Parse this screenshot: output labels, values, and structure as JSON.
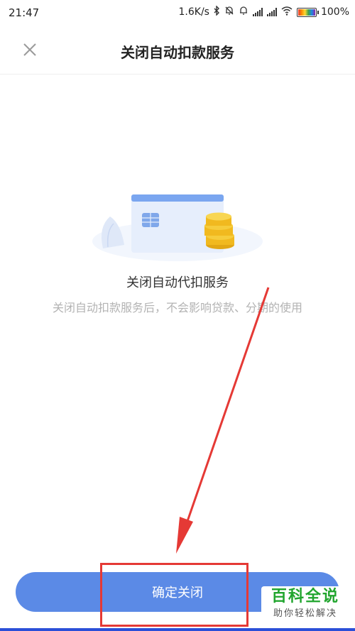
{
  "status_bar": {
    "time": "21:47",
    "speed": "1.6K/s",
    "battery": "100%"
  },
  "header": {
    "title": "关闭自动扣款服务",
    "close_icon": "close-icon"
  },
  "content": {
    "title": "关闭自动代扣服务",
    "description": "关闭自动扣款服务后，不会影响贷款、分期的使用"
  },
  "footer": {
    "confirm_label": "确定关闭"
  },
  "watermark": {
    "main": "百科全说",
    "sub": "助你轻松解决"
  },
  "colors": {
    "primary": "#5b8ae6",
    "annotation": "#e53935",
    "watermark_green": "#21a52e"
  }
}
